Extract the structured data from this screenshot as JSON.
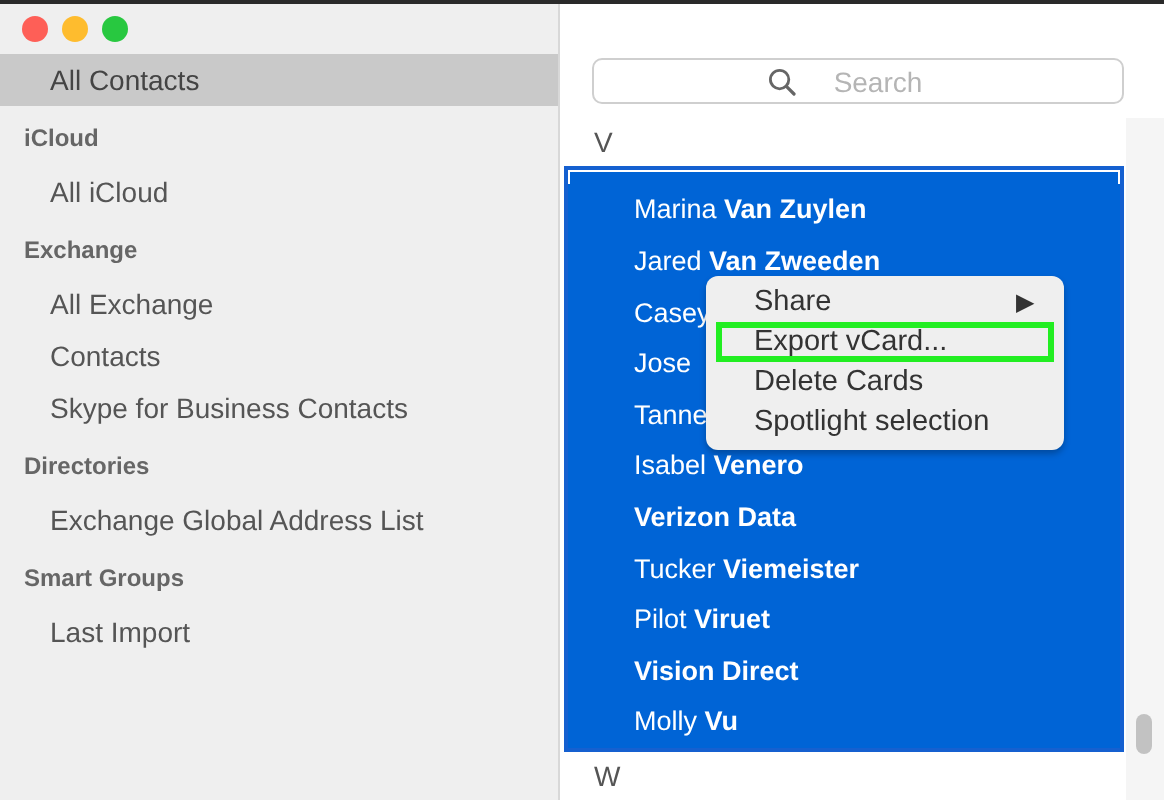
{
  "sidebar": {
    "top": [
      {
        "label": "All Contacts",
        "selected": true
      }
    ],
    "groups": [
      {
        "heading": "iCloud",
        "items": [
          {
            "label": "All iCloud",
            "selected": false
          }
        ]
      },
      {
        "heading": "Exchange",
        "items": [
          {
            "label": "All Exchange",
            "selected": false
          },
          {
            "label": "Contacts",
            "selected": false
          },
          {
            "label": "Skype for Business Contacts",
            "selected": false
          }
        ]
      },
      {
        "heading": "Directories",
        "items": [
          {
            "label": "Exchange Global Address List",
            "selected": false
          }
        ]
      },
      {
        "heading": "Smart Groups",
        "items": [
          {
            "label": "Last Import",
            "selected": false
          }
        ]
      }
    ]
  },
  "search": {
    "placeholder": "Search"
  },
  "contacts": {
    "sections": [
      {
        "letter": "V",
        "rows": [
          {
            "name": "Marina **Van Zuylen**",
            "selected": true
          },
          {
            "name": "Jared **Van Zweeden**",
            "selected": true
          },
          {
            "name": "Casey",
            "selected": true
          },
          {
            "name": "Jose",
            "selected": true
          },
          {
            "name": "Tanne",
            "selected": true
          },
          {
            "name": "Isabel **Venero**",
            "selected": true
          },
          {
            "name": "**Verizon Data**",
            "selected": true
          },
          {
            "name": "Tucker **Viemeister**",
            "selected": true
          },
          {
            "name": "Pilot **Viruet**",
            "selected": true
          },
          {
            "name": "**Vision Direct**",
            "selected": true
          },
          {
            "name": "Molly **Vu**",
            "selected": true
          }
        ]
      },
      {
        "letter": "W"
      }
    ]
  },
  "context_menu": {
    "items": [
      {
        "label": "Share",
        "submenu_arrow": "▶",
        "highlighted": false
      },
      {
        "label": "Export vCard...",
        "highlighted": true
      },
      {
        "label": "Delete Cards",
        "highlighted": false
      },
      {
        "label": "Spotlight selection",
        "highlighted": false
      }
    ]
  }
}
